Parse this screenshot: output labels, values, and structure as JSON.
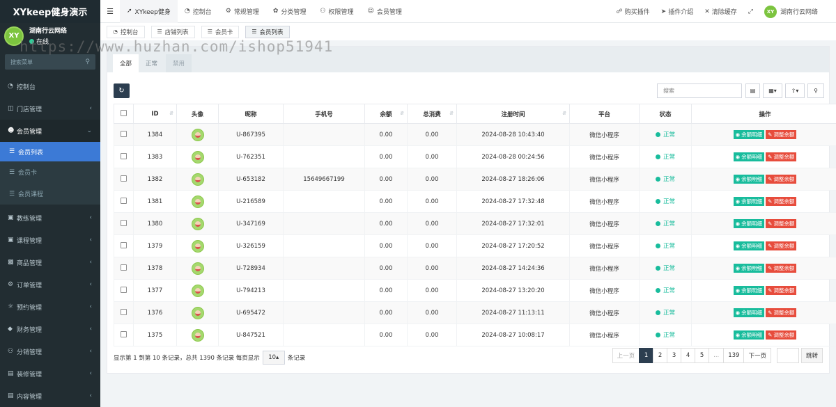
{
  "app": {
    "brand": "XYkeep健身演示",
    "logo_text": "XY"
  },
  "user": {
    "name": "湖南行云网络",
    "status": "在线"
  },
  "sidebar": {
    "search_placeholder": "搜索菜单",
    "items": [
      {
        "label": "控制台",
        "icon": "dashboard-icon"
      },
      {
        "label": "门店管理",
        "icon": "store-icon"
      },
      {
        "label": "会员管理",
        "icon": "user-icon"
      }
    ],
    "member_subs": [
      {
        "label": "会员列表"
      },
      {
        "label": "会员卡"
      },
      {
        "label": "会员课程"
      }
    ],
    "lower_items": [
      {
        "label": "教练管理"
      },
      {
        "label": "课程管理"
      },
      {
        "label": "商品管理"
      },
      {
        "label": "订单管理"
      },
      {
        "label": "预约管理"
      },
      {
        "label": "财务管理"
      },
      {
        "label": "分销管理"
      },
      {
        "label": "装修管理"
      },
      {
        "label": "内容管理"
      }
    ]
  },
  "topnav": {
    "items": [
      "XYkeep健身",
      "控制台",
      "常规管理",
      "分类管理",
      "权限管理",
      "会员管理"
    ],
    "right": [
      "购买插件",
      "插件介绍",
      "清除缓存"
    ],
    "org": "湖南行云网络"
  },
  "pagetabs": [
    "控制台",
    "店铺列表",
    "会员卡",
    "会员列表"
  ],
  "filter_tabs": [
    "全部",
    "正常",
    "禁用"
  ],
  "search_placeholder": "搜索",
  "table": {
    "headers": [
      "ID",
      "头像",
      "昵称",
      "手机号",
      "余额",
      "总消费",
      "注册时间",
      "平台",
      "状态",
      "操作"
    ],
    "rows": [
      {
        "id": "1384",
        "nick": "U-867395",
        "phone": "",
        "balance": "0.00",
        "spent": "0.00",
        "time": "2024-08-28 10:43:40",
        "platform": "微信小程序",
        "status": "正常"
      },
      {
        "id": "1383",
        "nick": "U-762351",
        "phone": "",
        "balance": "0.00",
        "spent": "0.00",
        "time": "2024-08-28 00:24:56",
        "platform": "微信小程序",
        "status": "正常"
      },
      {
        "id": "1382",
        "nick": "U-653182",
        "phone": "15649667199",
        "balance": "0.00",
        "spent": "0.00",
        "time": "2024-08-27 18:26:06",
        "platform": "微信小程序",
        "status": "正常"
      },
      {
        "id": "1381",
        "nick": "U-216589",
        "phone": "",
        "balance": "0.00",
        "spent": "0.00",
        "time": "2024-08-27 17:32:48",
        "platform": "微信小程序",
        "status": "正常"
      },
      {
        "id": "1380",
        "nick": "U-347169",
        "phone": "",
        "balance": "0.00",
        "spent": "0.00",
        "time": "2024-08-27 17:32:01",
        "platform": "微信小程序",
        "status": "正常"
      },
      {
        "id": "1379",
        "nick": "U-326159",
        "phone": "",
        "balance": "0.00",
        "spent": "0.00",
        "time": "2024-08-27 17:20:52",
        "platform": "微信小程序",
        "status": "正常"
      },
      {
        "id": "1378",
        "nick": "U-728934",
        "phone": "",
        "balance": "0.00",
        "spent": "0.00",
        "time": "2024-08-27 14:24:36",
        "platform": "微信小程序",
        "status": "正常"
      },
      {
        "id": "1377",
        "nick": "U-794213",
        "phone": "",
        "balance": "0.00",
        "spent": "0.00",
        "time": "2024-08-27 13:20:20",
        "platform": "微信小程序",
        "status": "正常"
      },
      {
        "id": "1376",
        "nick": "U-695472",
        "phone": "",
        "balance": "0.00",
        "spent": "0.00",
        "time": "2024-08-27 11:13:11",
        "platform": "微信小程序",
        "status": "正常"
      },
      {
        "id": "1375",
        "nick": "U-847521",
        "phone": "",
        "balance": "0.00",
        "spent": "0.00",
        "time": "2024-08-27 10:08:17",
        "platform": "微信小程序",
        "status": "正常"
      }
    ],
    "action_detail": "余额明细",
    "action_adjust": "调整余额"
  },
  "footer": {
    "info_prefix": "显示第 1 到第 10 条记录，总共 1390 条记录 每页显示",
    "page_size": "10",
    "info_suffix": "条记录"
  },
  "pagination": {
    "prev": "上一页",
    "pages": [
      "1",
      "2",
      "3",
      "4",
      "5",
      "...",
      "139"
    ],
    "next": "下一页",
    "jump": "跳转"
  },
  "watermark": "https://www.huzhan.com/ishop51941",
  "colors": {
    "sidebar_bg": "#222d32",
    "active": "#3c7ad6",
    "success": "#18bc9c",
    "danger": "#e74c3c",
    "primary_dark": "#2c3e50"
  }
}
